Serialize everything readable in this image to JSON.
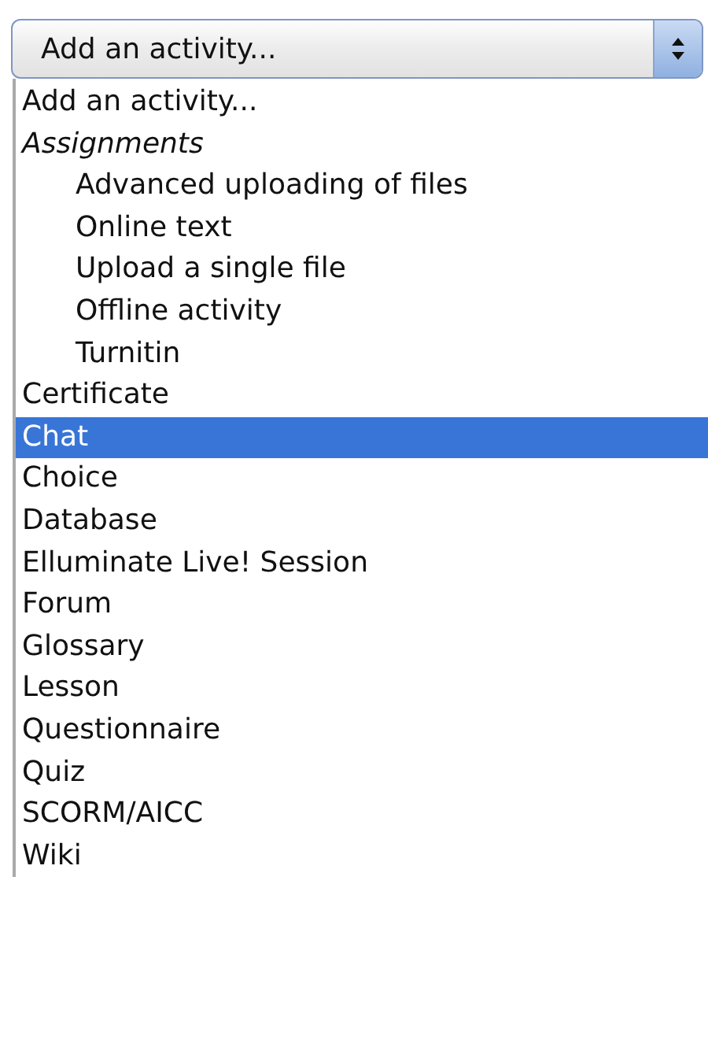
{
  "select": {
    "value": "Add an activity..."
  },
  "options": [
    {
      "kind": "option",
      "label": "Add an activity...",
      "selected": false
    },
    {
      "kind": "group",
      "label": "Assignments",
      "children": [
        {
          "kind": "option",
          "label": "Advanced uploading of files",
          "selected": false
        },
        {
          "kind": "option",
          "label": "Online text",
          "selected": false
        },
        {
          "kind": "option",
          "label": "Upload a single file",
          "selected": false
        },
        {
          "kind": "option",
          "label": "Offline activity",
          "selected": false
        },
        {
          "kind": "option",
          "label": "Turnitin",
          "selected": false
        }
      ]
    },
    {
      "kind": "option",
      "label": "Certificate",
      "selected": false
    },
    {
      "kind": "option",
      "label": "Chat",
      "selected": true
    },
    {
      "kind": "option",
      "label": "Choice",
      "selected": false
    },
    {
      "kind": "option",
      "label": "Database",
      "selected": false
    },
    {
      "kind": "option",
      "label": "Elluminate Live! Session",
      "selected": false
    },
    {
      "kind": "option",
      "label": "Forum",
      "selected": false
    },
    {
      "kind": "option",
      "label": "Glossary",
      "selected": false
    },
    {
      "kind": "option",
      "label": "Lesson",
      "selected": false
    },
    {
      "kind": "option",
      "label": "Questionnaire",
      "selected": false
    },
    {
      "kind": "option",
      "label": "Quiz",
      "selected": false
    },
    {
      "kind": "option",
      "label": "SCORM/AICC",
      "selected": false
    },
    {
      "kind": "option",
      "label": "Wiki",
      "selected": false
    }
  ]
}
